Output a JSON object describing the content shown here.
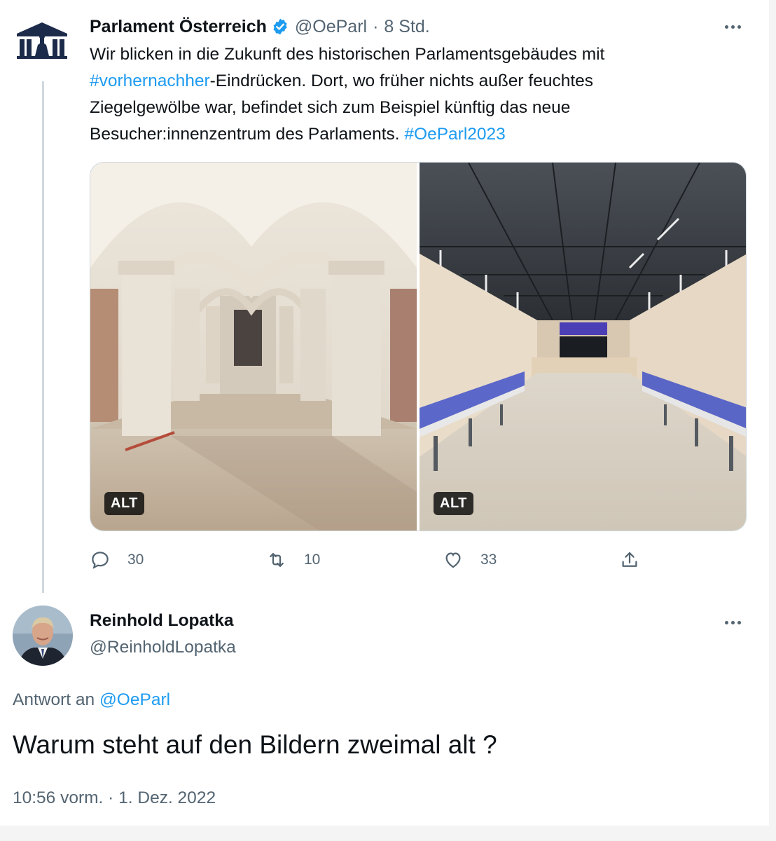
{
  "tweet": {
    "author_name": "Parlament Österreich",
    "handle": "@OeParl",
    "separator": "·",
    "time": "8 Std.",
    "verified": true,
    "text_lines": [
      {
        "pre": "Wir blicken in die Zukunft des historischen Parlamentsgebäudes mit",
        "link": "",
        "post": ""
      },
      {
        "pre": "",
        "link": "#vorhernachher",
        "post": "-Eindrücken. Dort, wo früher nichts außer feuchtes"
      },
      {
        "pre": "Ziegelgewölbe war, befindet sich zum Beispiel künftig das neue",
        "link": "",
        "post": ""
      },
      {
        "pre": "Besucher:innenzentrum des Parlaments. ",
        "link": "#OeParl2023",
        "post": ""
      }
    ],
    "media": [
      {
        "alt_label": "ALT",
        "depicts": "old-vaulted-cellar"
      },
      {
        "alt_label": "ALT",
        "depicts": "new-visitor-center"
      }
    ],
    "actions": {
      "reply_count": "30",
      "retweet_count": "10",
      "like_count": "33"
    }
  },
  "reply": {
    "author_name": "Reinhold Lopatka",
    "handle": "@ReinholdLopatka",
    "reply_prefix": "Antwort an",
    "reply_target": "@OeParl",
    "text": "Warum steht auf den Bildern zweimal alt ?",
    "timestamp": "10:56 vorm. · 1. Dez. 2022"
  },
  "colors": {
    "link": "#1d9bf0",
    "secondary_text": "#536471",
    "verified": "#1d9bf0"
  }
}
